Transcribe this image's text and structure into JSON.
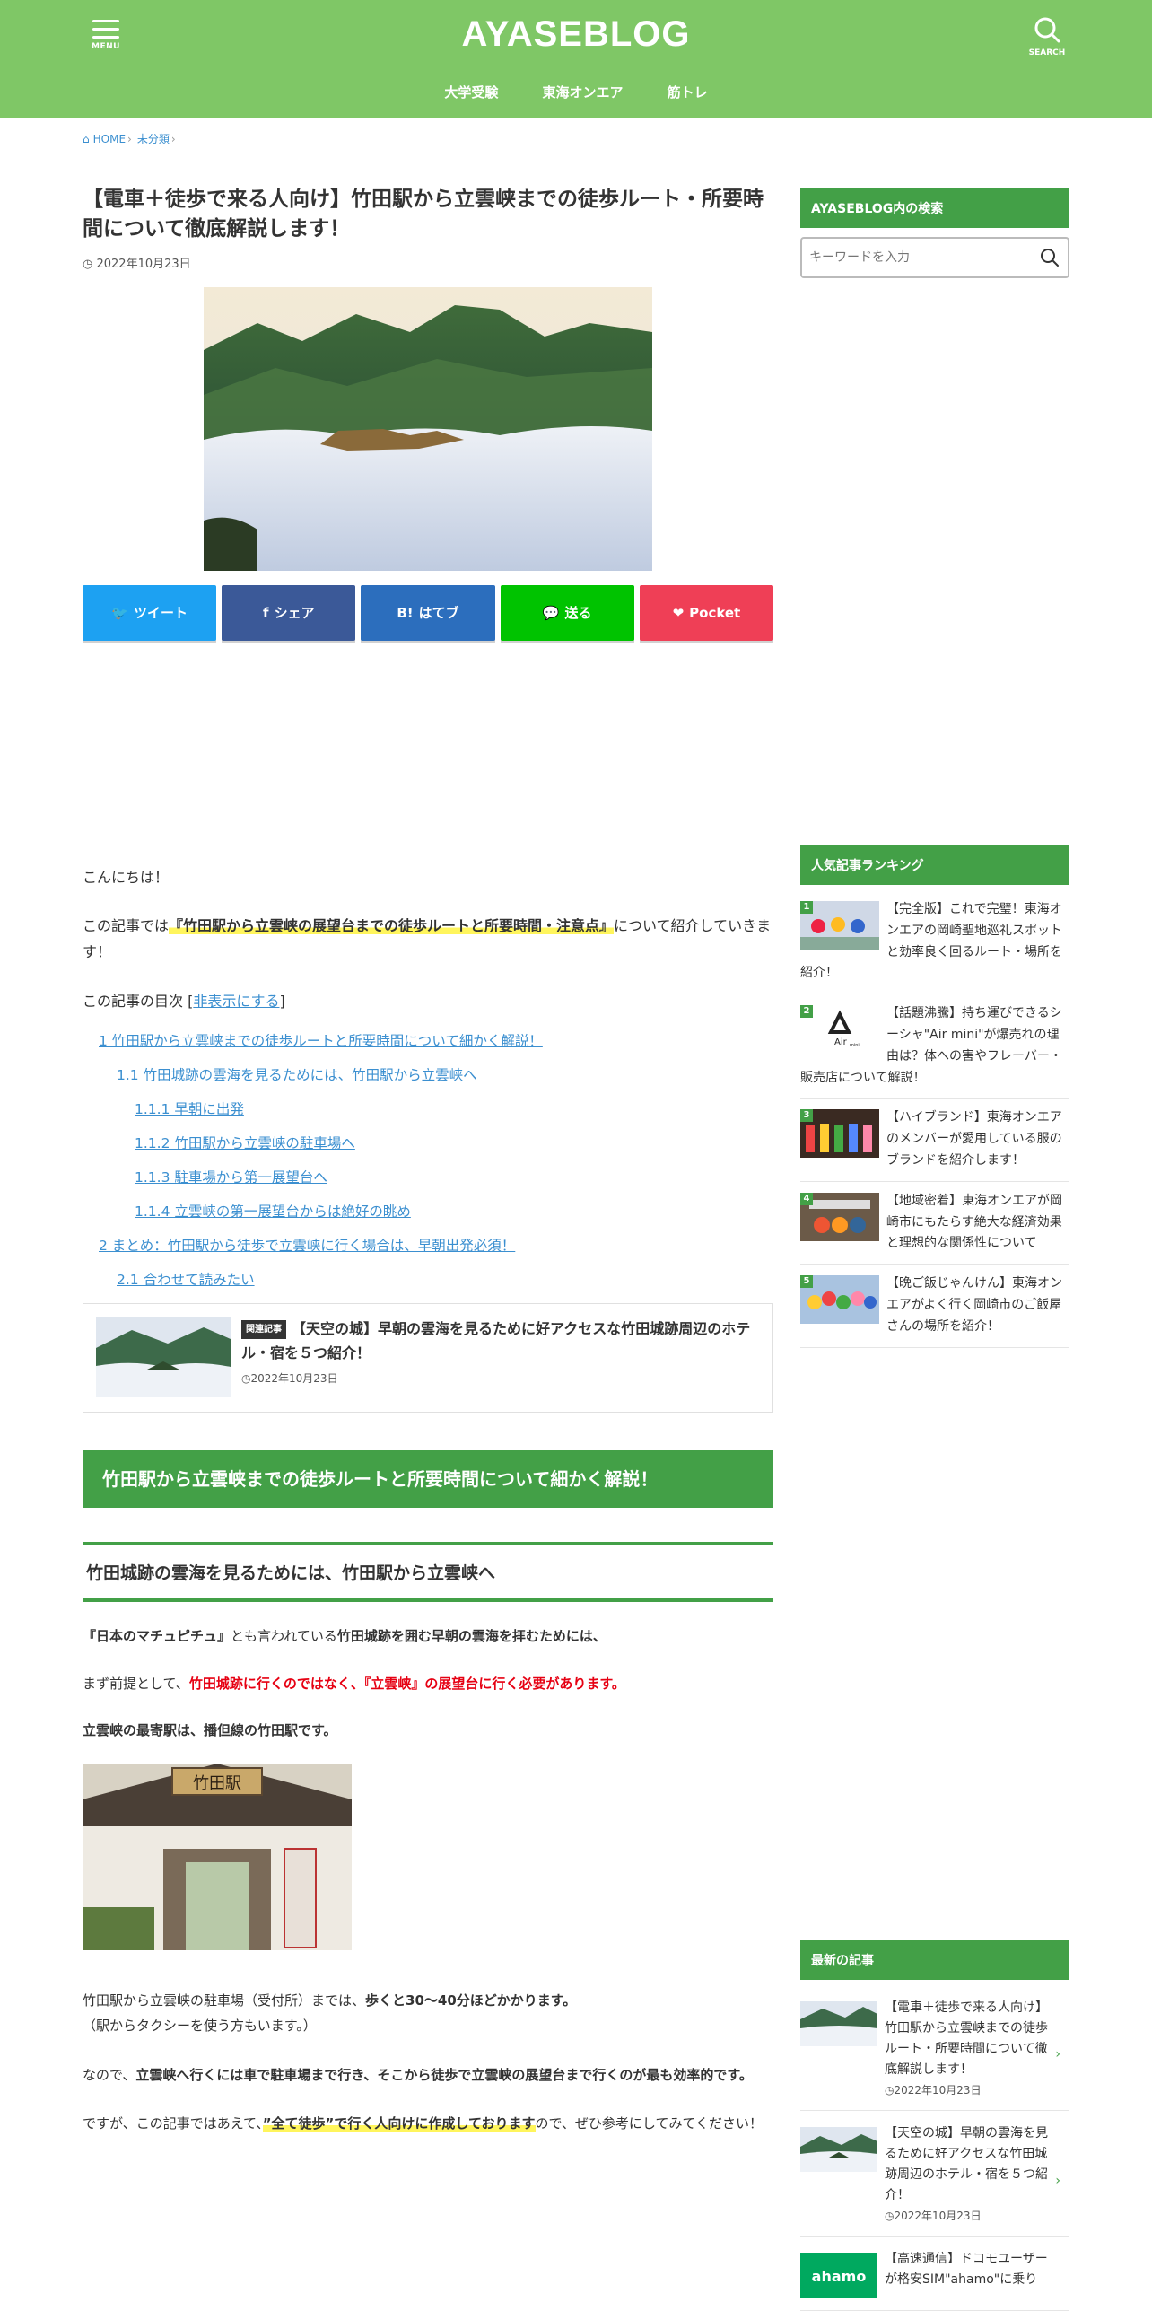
{
  "header": {
    "site_title": "AYASEBLOG",
    "menu_caption": "MENU",
    "search_caption": "SEARCH",
    "nav": [
      "大学受験",
      "東海オンエア",
      "筋トレ"
    ],
    "bg_color": "#7fc766"
  },
  "breadcrumb": [
    "HOME",
    "未分類"
  ],
  "post": {
    "title": "【電車＋徒歩で来る人向け】竹田駅から立雲峡までの徒歩ルート・所要時間について徹底解説します！",
    "date": "2022年10月23日"
  },
  "share": {
    "twitter": "ツイート",
    "facebook": "シェア",
    "hatena": "はてブ",
    "line": "送る",
    "pocket": "Pocket"
  },
  "content": {
    "greeting": "こんにちは！",
    "intro_pre": "この記事では",
    "intro_hl": "『竹田駅から立雲峡の展望台までの徒歩ルートと所要時間・注意点』",
    "intro_post": "について紹介していきます！",
    "toc_label": "この記事の目次 [",
    "toc_toggle": "非表示にする",
    "toc_label_end": "]",
    "toc": [
      {
        "level": 1,
        "text": "1 竹田駅から立雲峡までの徒歩ルートと所要時間について細かく解説！"
      },
      {
        "level": 2,
        "text": "1.1 竹田城跡の雲海を見るためには、竹田駅から立雲峡へ"
      },
      {
        "level": 3,
        "text": "1.1.1 早朝に出発"
      },
      {
        "level": 3,
        "text": "1.1.2 竹田駅から立雲峡の駐車場へ"
      },
      {
        "level": 3,
        "text": "1.1.3 駐車場から第一展望台へ"
      },
      {
        "level": 3,
        "text": "1.1.4 立雲峡の第一展望台からは絶好の眺め"
      },
      {
        "level": 1,
        "text": "2 まとめ：竹田駅から徒歩で立雲峡に行く場合は、早朝出発必須！"
      },
      {
        "level": 2,
        "text": "2.1 合わせて読みたい"
      }
    ],
    "related": {
      "badge": "関連記事",
      "title": "【天空の城】早朝の雲海を見るために好アクセスな竹田城跡周辺のホテル・宿を５つ紹介！",
      "date": "2022年10月23日"
    },
    "h2": "竹田駅から立雲峡までの徒歩ルートと所要時間について細かく解説！",
    "h3": "竹田城跡の雲海を見るためには、竹田駅から立雲峡へ",
    "p1_a": "『日本のマチュピチュ』",
    "p1_b": "とも言われている",
    "p1_c": "竹田城跡を囲む早朝の雲海を拝むためには、",
    "p2_a": "まず前提として、",
    "p2_b": "竹田城跡に行くのではなく、『立雲峡』の展望台に行く必要があります。",
    "p3": "立雲峡の最寄駅は、播但線の竹田駅です。",
    "station_sign": "竹田駅",
    "p4_a": "竹田駅から立雲峡の駐車場（受付所）までは、",
    "p4_b": "歩くと30〜40分ほどかかります。",
    "p4_c": "（駅からタクシーを使う方もいます。）",
    "p5_a": "なので、",
    "p5_b": "立雲峡へ行くには車で駐車場まで行き、そこから徒歩で立雲峡の展望台まで行くのが最も効率的です。",
    "p6_a": "ですが、この記事ではあえて、",
    "p6_b": "”全て徒歩”で行く人向けに作成しております",
    "p6_c": "ので、ぜひ参考にしてみてください！"
  },
  "sidebar": {
    "search_title": "AYASEBLOG内の検索",
    "search_placeholder": "キーワードを入力",
    "ranking_title": "人気記事ランキング",
    "ranking": [
      {
        "rank": "1",
        "title": "【完全版】これで完璧！東海オンエアの岡崎聖地巡礼スポットと効率良く回るルート・場所を紹介！"
      },
      {
        "rank": "2",
        "title": "【話題沸騰】持ち運びできるシーシャ\"Air mini\"が爆売れの理由は？体への害やフレーバー・販売店について解説！",
        "logo_top": "Air",
        "logo_sub": "mini"
      },
      {
        "rank": "3",
        "title": "【ハイブランド】東海オンエアのメンバーが愛用している服のブランドを紹介します！"
      },
      {
        "rank": "4",
        "title": "【地域密着】東海オンエアが岡崎市にもたらす絶大な経済効果と理想的な関係性について"
      },
      {
        "rank": "5",
        "title": "【晩ご飯じゃんけん】東海オンエアがよく行く岡崎市のご飯屋さんの場所を紹介！"
      }
    ],
    "new_title": "最新の記事",
    "new_posts": [
      {
        "title": "【電車＋徒歩で来る人向け】竹田駅から立雲峡までの徒歩ルート・所要時間について徹底解説します！",
        "date": "2022年10月23日"
      },
      {
        "title": "【天空の城】早朝の雲海を見るために好アクセスな竹田城跡周辺のホテル・宿を５つ紹介！",
        "date": "2022年10月23日"
      },
      {
        "title": "【高速通信】ドコモユーザーが格安SIM\"ahamo\"に乗り",
        "date": "",
        "logo": "ahamo"
      }
    ]
  },
  "colors": {
    "accent_green": "#43a047",
    "link_blue": "#3b8fd0",
    "red_emphasis": "#e60012"
  }
}
